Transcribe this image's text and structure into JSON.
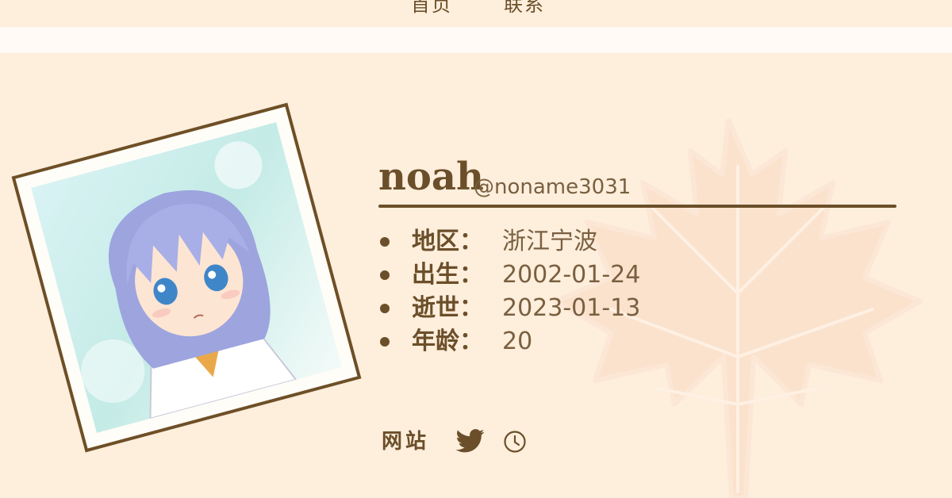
{
  "nav": {
    "home_label": "首页",
    "contact_label": "联系"
  },
  "profile": {
    "name": "noah",
    "handle": "@noname3031"
  },
  "info": [
    {
      "label": "地区：",
      "value": "浙江宁波"
    },
    {
      "label": "出生：",
      "value": "2002-01-24"
    },
    {
      "label": "逝世：",
      "value": "2023-01-13"
    },
    {
      "label": "年龄：",
      "value": "20"
    }
  ],
  "links": {
    "site_label": "网站",
    "twitter_icon": "twitter-icon",
    "clock_icon": "clock-icon"
  },
  "colors": {
    "background": "#feeedc",
    "text": "#6b4f2a",
    "frame": "#6e4f26",
    "leaf": "#f9ddc8"
  }
}
